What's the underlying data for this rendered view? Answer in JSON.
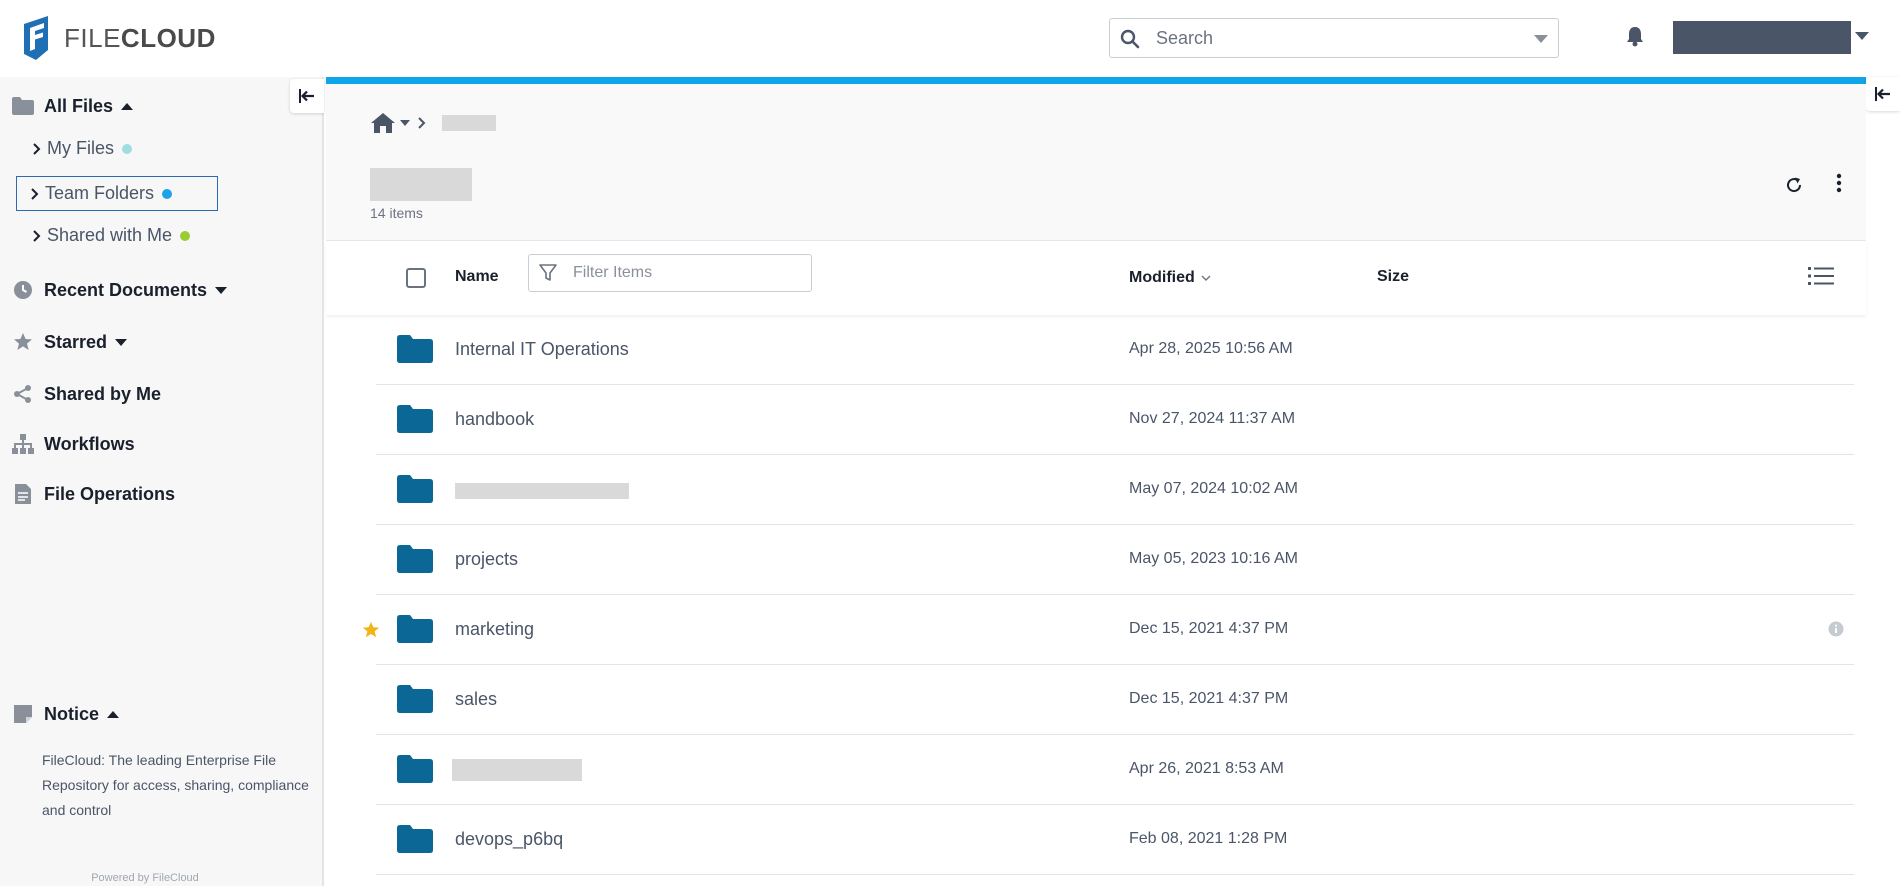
{
  "header": {
    "logo_text_light": "FILE",
    "logo_text_bold": "CLOUD",
    "search_placeholder": "Search"
  },
  "sidebar": {
    "all_files": "All Files",
    "sub_items": [
      {
        "label": "My Files",
        "dot_color": "#a0dde0"
      },
      {
        "label": "Team Folders",
        "dot_color": "#1fa3e6"
      },
      {
        "label": "Shared with Me",
        "dot_color": "#9acd32"
      }
    ],
    "recent_documents": "Recent Documents",
    "starred": "Starred",
    "shared_by_me": "Shared by Me",
    "workflows": "Workflows",
    "file_operations": "File Operations",
    "notice_title": "Notice",
    "notice_text": "FileCloud: The leading Enterprise File Repository for access, sharing, compliance and control",
    "powered_by": "Powered by FileCloud"
  },
  "main": {
    "items_count": "14 items",
    "columns": {
      "name": "Name",
      "filter_placeholder": "Filter Items",
      "modified": "Modified",
      "size": "Size"
    },
    "rows": [
      {
        "name": "Internal IT Operations",
        "modified": "Apr 28, 2025 10:56 AM",
        "starred": false
      },
      {
        "name": "handbook",
        "modified": "Nov 27, 2024 11:37 AM",
        "starred": false
      },
      {
        "name": "",
        "modified": "May 07, 2024 10:02 AM",
        "starred": false
      },
      {
        "name": "projects",
        "modified": "May 05, 2023 10:16 AM",
        "starred": false
      },
      {
        "name": "marketing",
        "modified": "Dec 15, 2021 4:37 PM",
        "starred": true
      },
      {
        "name": "sales",
        "modified": "Dec 15, 2021 4:37 PM",
        "starred": false
      },
      {
        "name": "",
        "modified": "Apr 26, 2021 8:53 AM",
        "starred": false
      },
      {
        "name": "devops_p6bq",
        "modified": "Feb 08, 2021 1:28 PM",
        "starred": false
      }
    ]
  },
  "colors": {
    "accent": "#0ea5e9",
    "folder": "#0a6796",
    "star": "#f2b417"
  }
}
